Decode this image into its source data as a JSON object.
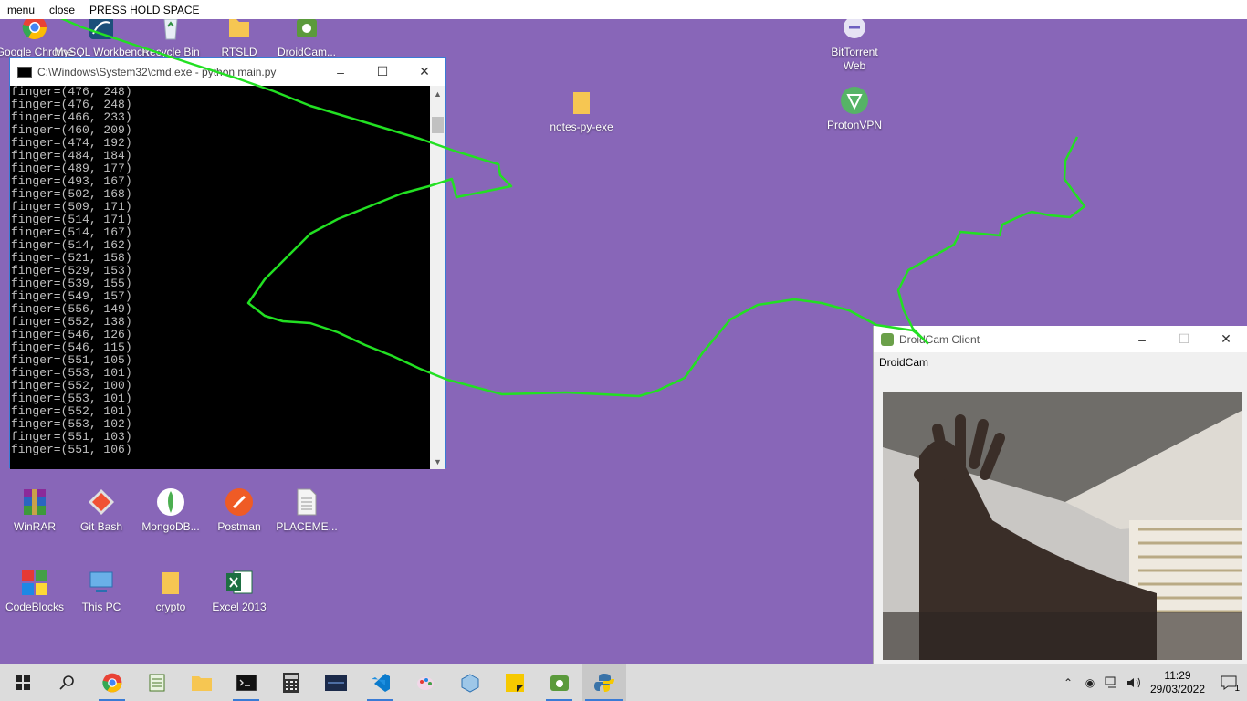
{
  "overlay": {
    "menu": "menu",
    "close": "close",
    "instruction": "PRESS  HOLD SPACE"
  },
  "desktop_icons": {
    "google_chrome": "Google Chrome",
    "mysql": "MySQL Workbench",
    "recycle_bin": "Recycle Bin",
    "rtsld": "RTSLD",
    "droidcam": "DroidCam...",
    "bittorrent_1": "BitTorrent",
    "bittorrent_2": "Web",
    "notes": "notes-py-exe",
    "protonvpn": "ProtonVPN",
    "winrar": "WinRAR",
    "gitbash": "Git Bash",
    "mongodb": "MongoDB...",
    "postman": "Postman",
    "placement": "PLACEME...",
    "codeblocks": "CodeBlocks",
    "thispc": "This PC",
    "crypto": "crypto",
    "excel": "Excel 2013"
  },
  "cmd": {
    "title": "C:\\Windows\\System32\\cmd.exe - python  main.py",
    "lines": [
      "finger=(476, 248)",
      "finger=(476, 248)",
      "finger=(466, 233)",
      "finger=(460, 209)",
      "finger=(474, 192)",
      "finger=(484, 184)",
      "finger=(489, 177)",
      "finger=(493, 167)",
      "finger=(502, 168)",
      "finger=(509, 171)",
      "finger=(514, 171)",
      "finger=(514, 167)",
      "finger=(514, 162)",
      "finger=(521, 158)",
      "finger=(529, 153)",
      "finger=(539, 155)",
      "finger=(549, 157)",
      "finger=(556, 149)",
      "finger=(552, 138)",
      "finger=(546, 126)",
      "finger=(546, 115)",
      "finger=(551, 105)",
      "finger=(553, 101)",
      "finger=(552, 100)",
      "finger=(553, 101)",
      "finger=(552, 101)",
      "finger=(553, 102)",
      "finger=(551, 103)",
      "finger=(551, 106)"
    ]
  },
  "droidcam": {
    "title": "DroidCam Client",
    "menu": "DroidCam"
  },
  "clock": {
    "time": "11:29",
    "date": "29/03/2022"
  },
  "notifications": "1",
  "colors": {
    "desktop": "#8866b8",
    "trace": "#22e022",
    "accent": "#3a7bd5"
  }
}
